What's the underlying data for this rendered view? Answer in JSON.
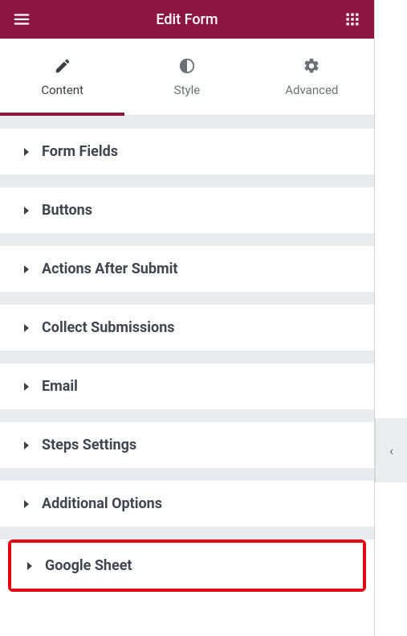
{
  "header": {
    "title": "Edit Form"
  },
  "tabs": [
    {
      "id": "content",
      "label": "Content",
      "active": true
    },
    {
      "id": "style",
      "label": "Style",
      "active": false
    },
    {
      "id": "advanced",
      "label": "Advanced",
      "active": false
    }
  ],
  "sections": [
    {
      "id": "form-fields",
      "label": "Form Fields"
    },
    {
      "id": "buttons",
      "label": "Buttons"
    },
    {
      "id": "actions-after-submit",
      "label": "Actions After Submit"
    },
    {
      "id": "collect-submissions",
      "label": "Collect Submissions"
    },
    {
      "id": "email",
      "label": "Email"
    },
    {
      "id": "steps-settings",
      "label": "Steps Settings"
    },
    {
      "id": "additional-options",
      "label": "Additional Options"
    },
    {
      "id": "google-sheet",
      "label": "Google Sheet",
      "highlighted": true
    }
  ],
  "collapse_handle": {
    "glyph": "‹"
  }
}
